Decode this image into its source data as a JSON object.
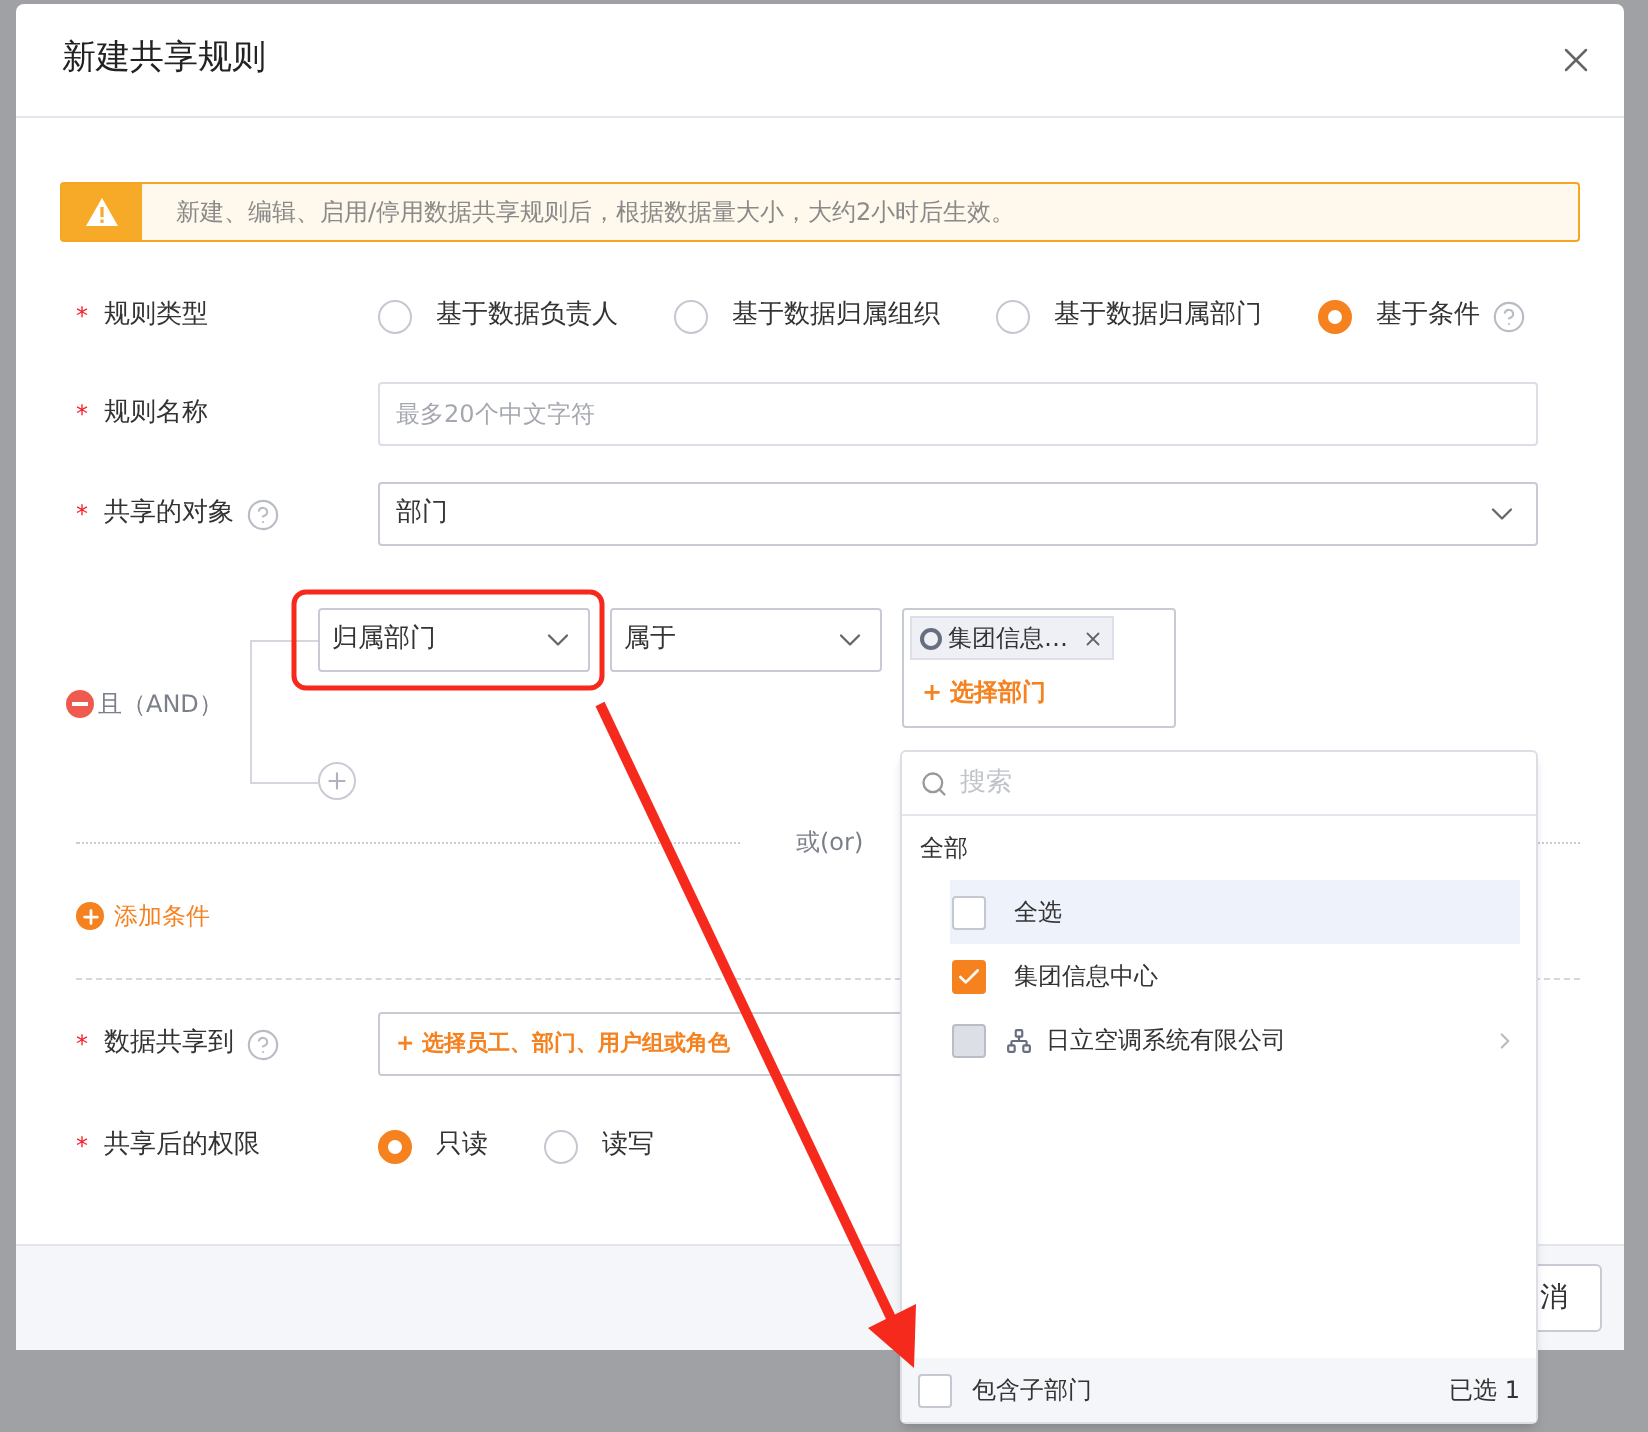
{
  "dialog": {
    "title": "新建共享规则"
  },
  "notice": "新建、编辑、启用/停用数据共享规则后，根据数据量大小，大约2小时后生效。",
  "rule_type": {
    "label": "规则类型",
    "required_mark": "*",
    "options": [
      {
        "label": "基于数据负责人",
        "selected": false
      },
      {
        "label": "基于数据归属组织",
        "selected": false
      },
      {
        "label": "基于数据归属部门",
        "selected": false
      },
      {
        "label": "基于条件",
        "selected": true,
        "help": true
      }
    ]
  },
  "rule_name": {
    "label": "规则名称",
    "required_mark": "*",
    "placeholder": "最多20个中文字符"
  },
  "share_object": {
    "label": "共享的对象",
    "required_mark": "*",
    "help": true,
    "value": "部门"
  },
  "condition_group": {
    "logic": "且（AND）",
    "conditions": [
      {
        "field": "归属部门",
        "operator": "属于",
        "tags": [
          "集团信息…"
        ],
        "add_label": "+ 选择部门"
      }
    ]
  },
  "or_separator": "或(or)",
  "add_condition": "添加条件",
  "share_to": {
    "label": "数据共享到",
    "required_mark": "*",
    "help": true,
    "placeholder": "+ 选择员工、部门、用户组或角色"
  },
  "permission": {
    "label": "共享后的权限",
    "required_mark": "*",
    "options": [
      {
        "label": "只读",
        "selected": true
      },
      {
        "label": "读写",
        "selected": false
      }
    ]
  },
  "footer_button": "消",
  "dropdown": {
    "search_placeholder": "搜索",
    "group": "全部",
    "items": [
      {
        "label": "全选",
        "checked": false,
        "selected": true,
        "disabled": false,
        "kind": "plain"
      },
      {
        "label": "集团信息中心",
        "checked": true,
        "selected": false,
        "disabled": false,
        "kind": "plain"
      },
      {
        "label": "日立空调系统有限公司",
        "checked": false,
        "selected": false,
        "disabled": true,
        "kind": "org"
      }
    ],
    "include_children": {
      "label": "包含子部门",
      "checked": false
    },
    "selected_count": "已选 1"
  }
}
